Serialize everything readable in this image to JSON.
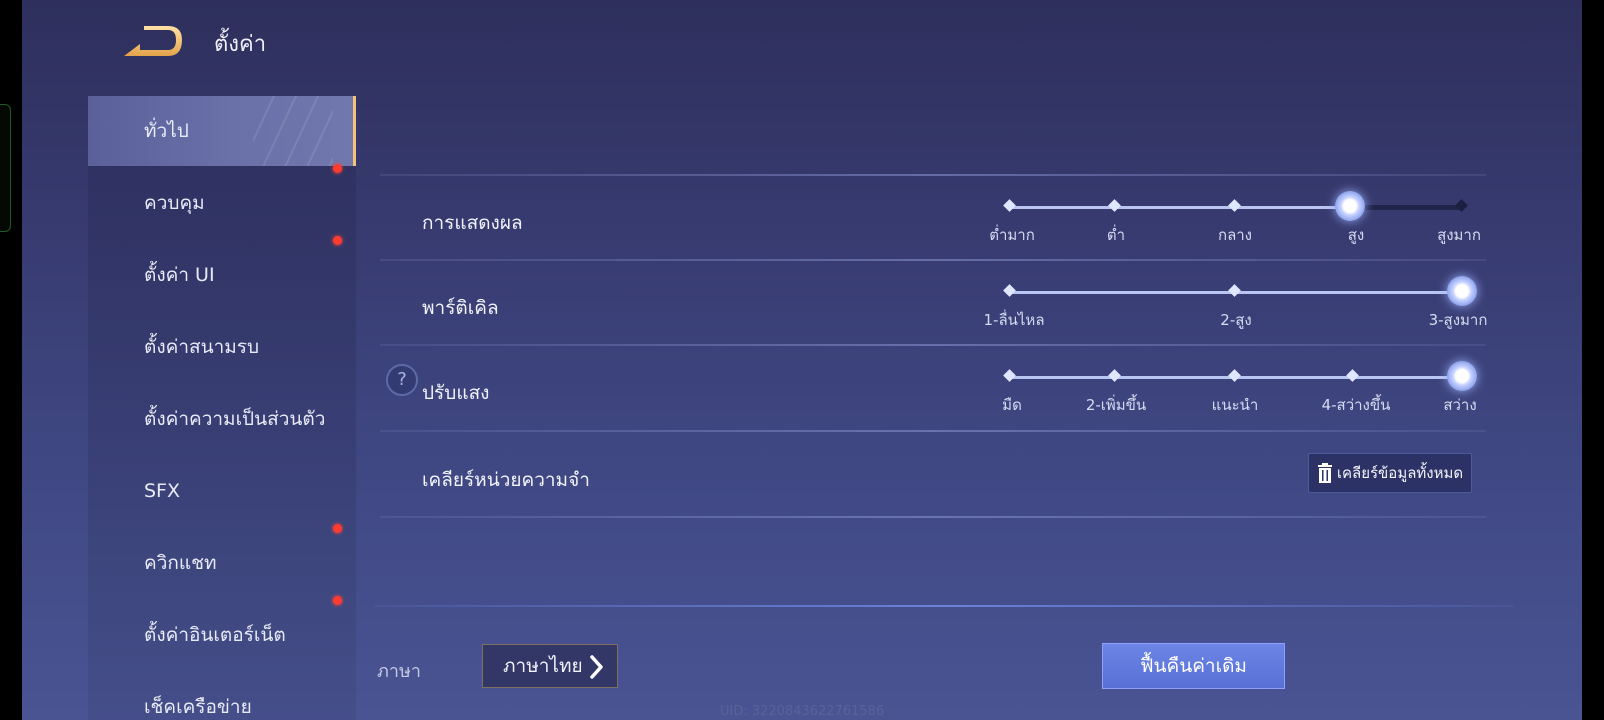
{
  "header": {
    "title": "ตั้งค่า"
  },
  "sidebar": {
    "items": [
      {
        "label": "ทั่วไป",
        "active": true,
        "badge": false
      },
      {
        "label": "ควบคุม",
        "active": false,
        "badge": true
      },
      {
        "label": "ตั้งค่า UI",
        "active": false,
        "badge": true
      },
      {
        "label": "ตั้งค่าสนามรบ",
        "active": false,
        "badge": false
      },
      {
        "label": "ตั้งค่าความเป็นส่วนตัว",
        "active": false,
        "badge": false
      },
      {
        "label": "SFX",
        "active": false,
        "badge": false
      },
      {
        "label": "ควิกแชท",
        "active": false,
        "badge": true
      },
      {
        "label": "ตั้งค่าอินเตอร์เน็ต",
        "active": false,
        "badge": true
      },
      {
        "label": "เช็คเครือข่าย",
        "active": false,
        "badge": false
      }
    ]
  },
  "settings": {
    "display": {
      "label": "การแสดงผล",
      "options": [
        "ต่ำมาก",
        "ต่ำ",
        "กลาง",
        "สูง",
        "สูงมาก"
      ],
      "selected": "สูง"
    },
    "particle": {
      "label": "พาร์ติเคิล",
      "options": [
        "1-ลื่นไหล",
        "2-สูง",
        "3-สูงมาก"
      ],
      "selected": "3-สูงมาก"
    },
    "brightness": {
      "label": "ปรับแสง",
      "options": [
        "มืด",
        "2-เพิ่มขึ้น",
        "แนะนำ",
        "4-สว่างขึ้น",
        "สว่าง"
      ],
      "selected": "สว่าง"
    },
    "cache": {
      "label": "เคลียร์หน่วยความจำ",
      "button": "เคลียร์ข้อมูลทั้งหมด"
    }
  },
  "language": {
    "label": "ภาษา",
    "value": "ภาษาไทย"
  },
  "restore_button": "ฟื้นคืนค่าเดิม",
  "uid": "UID: 3220843622761586",
  "colors": {
    "accent": "#f3c37a",
    "badge": "#ff3a2e",
    "slider_track": "#b9c6f2",
    "restore_button": "#5f78dd"
  }
}
